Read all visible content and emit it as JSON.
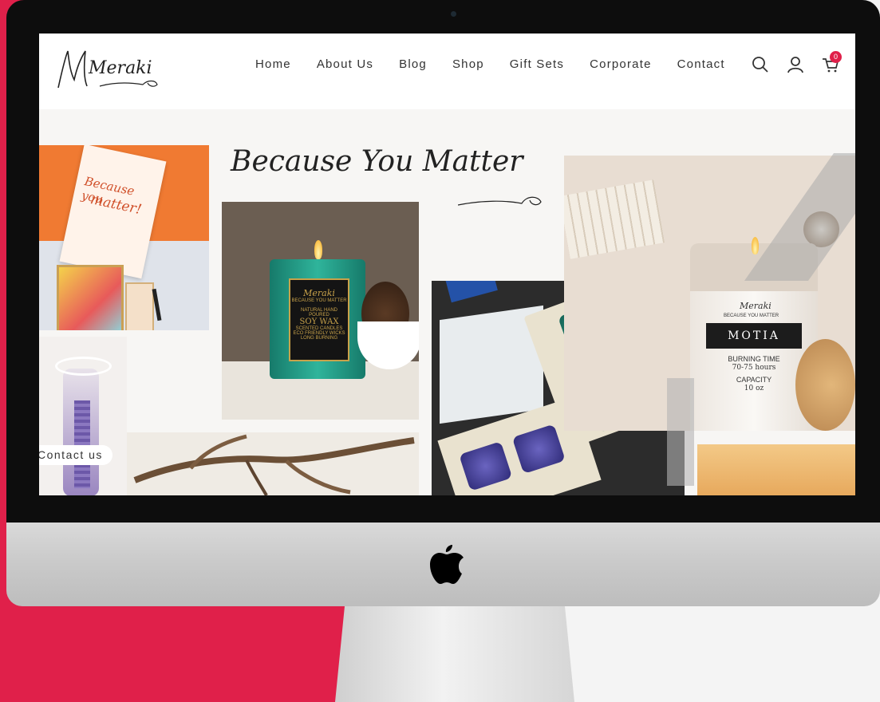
{
  "brand": {
    "logo_text": "Meraki"
  },
  "nav": {
    "items": [
      "Home",
      "About Us",
      "Blog",
      "Shop",
      "Gift Sets",
      "Corporate",
      "Contact"
    ],
    "cart_count": "0"
  },
  "hero": {
    "tagline": "Because You Matter",
    "contact_button": "Contact us",
    "card_text": {
      "note_line1": "Because you",
      "note_line2": "matter!"
    },
    "candle1": {
      "brand": "Meraki",
      "sub": "BECAUSE YOU MATTER",
      "line1": "NATURAL HAND POURED",
      "line2": "SOY WAX",
      "line3": "SCENTED CANDLES",
      "line4": "ECO FRIENDLY WICKS",
      "line5": "LONG BURNING"
    },
    "candle2": {
      "brand": "Meraki",
      "sub": "BECAUSE YOU MATTER",
      "name": "MOTIA",
      "burn_label": "BURNING TIME",
      "burn_value": "70-75 hours",
      "cap_label": "CAPACITY",
      "cap_value": "10 oz"
    }
  },
  "colors": {
    "accent": "#e0204a",
    "teal": "#1e8a78",
    "orange": "#f07a32"
  },
  "icons": [
    "search-icon",
    "user-icon",
    "cart-icon",
    "apple-logo-icon"
  ]
}
